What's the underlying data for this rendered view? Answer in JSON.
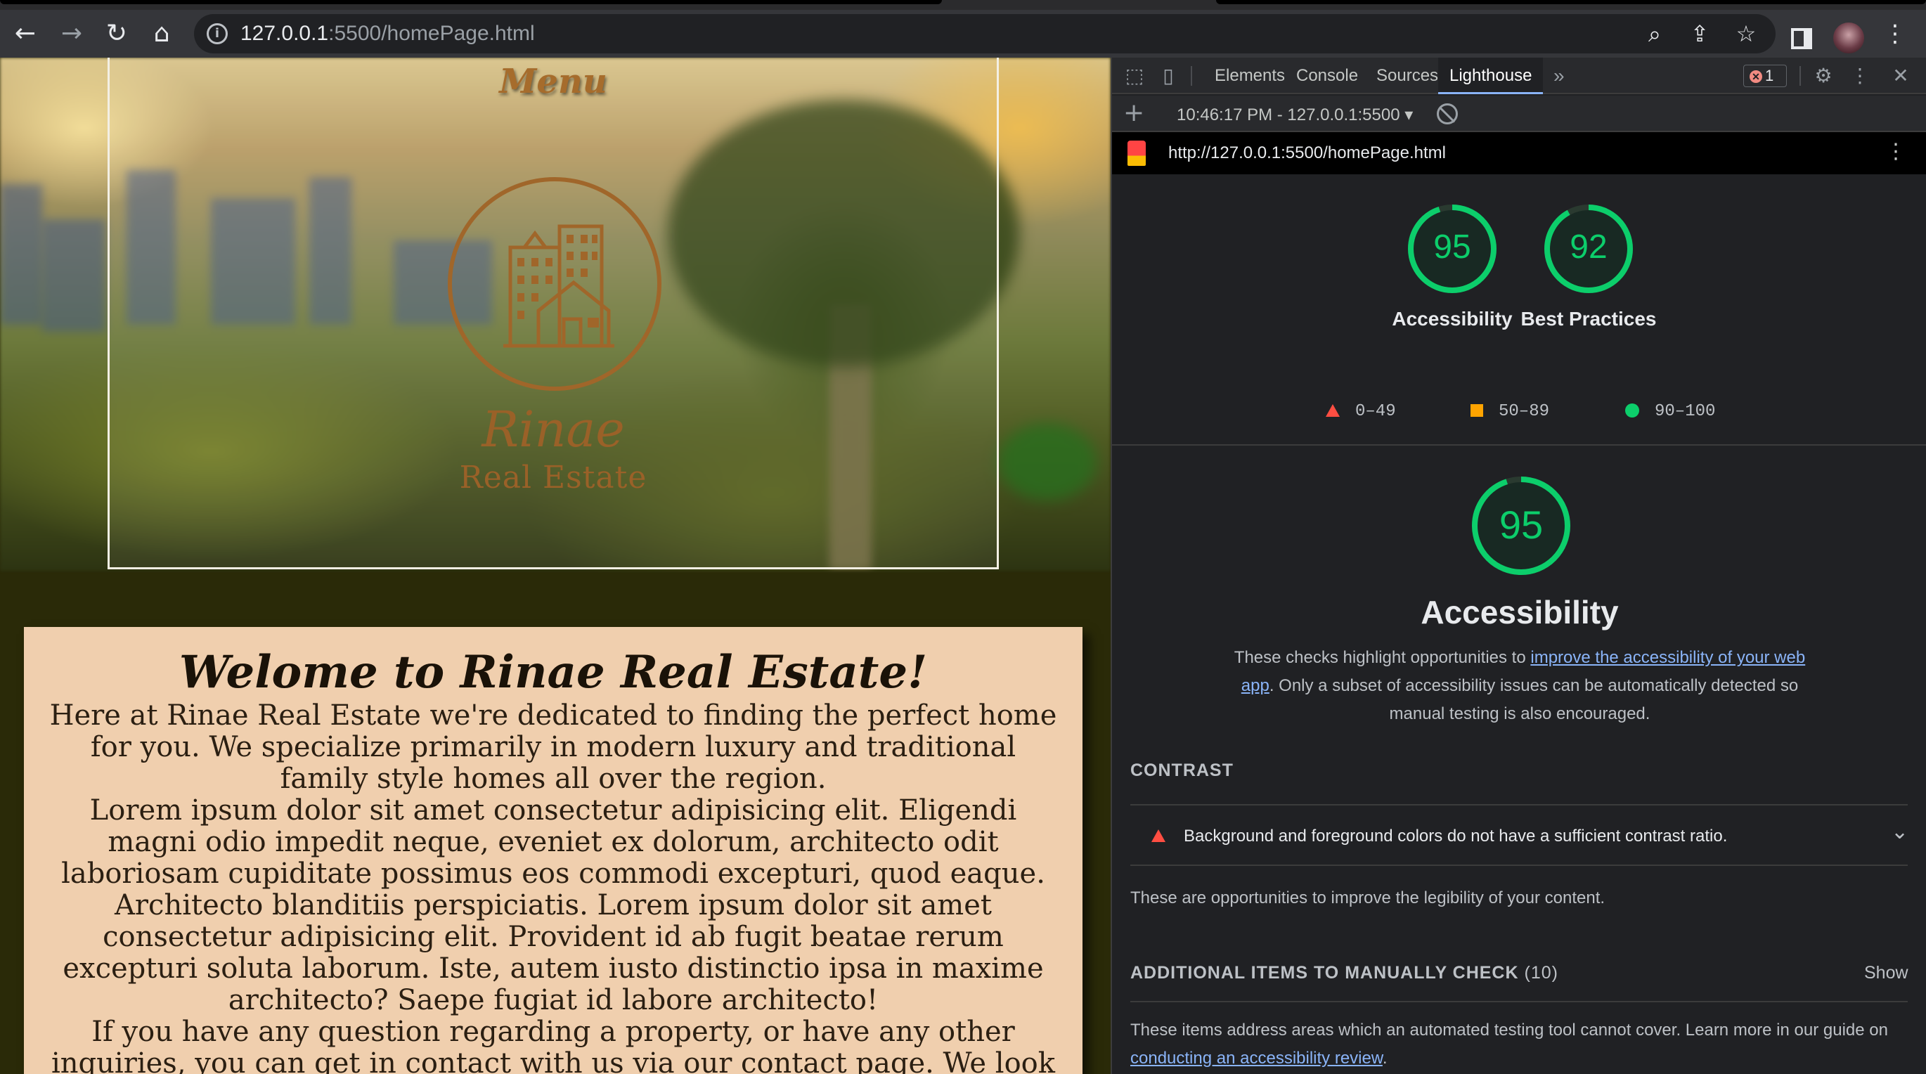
{
  "browser": {
    "url_host": "127.0.0.1",
    "url_rest": ":5500/homePage.html",
    "back_icon": "arrow-left-icon",
    "forward_icon": "arrow-right-icon",
    "reload_icon": "reload-icon",
    "home_icon": "home-icon"
  },
  "website": {
    "menu_title": "Menu",
    "brand_name": "Rinae",
    "brand_sub": "Real Estate",
    "welcome_title": "Welome to Rinae Real Estate!",
    "welcome_body": "Here at Rinae Real Estate we're dedicated to finding the perfect home for you. We specialize primarily in modern luxury and traditional family style homes all over the region.",
    "welcome_body2": "Lorem ipsum dolor sit amet consectetur adipisicing elit. Eligendi magni odio impedit neque, eveniet ex dolorum, architecto odit laboriosam cupiditate possimus eos commodi excepturi, quod eaque. Architecto blanditiis perspiciatis. Lorem ipsum dolor sit amet consectetur adipisicing elit. Provident id ab fugit beatae rerum excepturi soluta laborum. Iste, autem iusto distinctio ipsa in maxime architecto? Saepe fugiat id labore architecto!",
    "welcome_body3": "If you have any question regarding a property, or have any other inquiries, you can get in contact with us via our contact page. We look forward to finding your perfect home!"
  },
  "devtools": {
    "tabs": [
      "Elements",
      "Console",
      "Sources",
      "Lighthouse"
    ],
    "active_tab": "Lighthouse",
    "more_tabs": "»",
    "error_count": "1",
    "report_select": "10:46:17 PM - 127.0.0.1:5500 ▾",
    "report_url": "http://127.0.0.1:5500/homePage.html",
    "scores": [
      {
        "value": 95,
        "label": "Accessibility"
      },
      {
        "value": 92,
        "label": "Best Practices"
      }
    ],
    "legend": {
      "fail": "0–49",
      "average": "50–89",
      "pass": "90–100"
    },
    "category": {
      "score": 95,
      "title": "Accessibility",
      "desc_before": "These checks highlight opportunities to ",
      "desc_link": "improve the accessibility of your web app",
      "desc_after": ". Only a subset of accessibility issues can be automatically detected so manual testing is also encouraged."
    },
    "contrast": {
      "title": "CONTRAST",
      "audit": "Background and foreground colors do not have a sufficient contrast ratio.",
      "note": "These are opportunities to improve the legibility of your content."
    },
    "manual": {
      "title": "ADDITIONAL ITEMS TO MANUALLY CHECK",
      "count": "(10)",
      "show": "Show",
      "note_before": "These items address areas which an automated testing tool cannot cover. Learn more in our guide on ",
      "note_link": "conducting an accessibility review",
      "note_after": "."
    },
    "colors": {
      "pass": "#0cce6b",
      "average": "#ffa400",
      "fail": "#ff4e42",
      "link": "#8ab4f8"
    }
  }
}
